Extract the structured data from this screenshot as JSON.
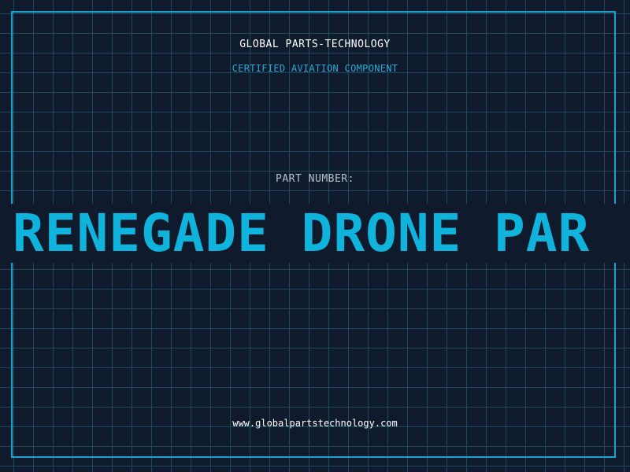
{
  "header": {
    "brand": "GLOBAL PARTS-TECHNOLOGY",
    "subtitle": "CERTIFIED AVIATION COMPONENT"
  },
  "part": {
    "label": "PART NUMBER:",
    "number_visible": "RENEGADE DRONE PAR"
  },
  "footer": {
    "url": "www.globalpartstechnology.com"
  },
  "colors": {
    "background": "#0f1b2d",
    "grid": "#1d4a5e",
    "border": "#1aa3cf",
    "accent": "#0fb3dc",
    "subtitle": "#2aa8d8",
    "label": "#b8c2ce",
    "text": "#ffffff"
  }
}
